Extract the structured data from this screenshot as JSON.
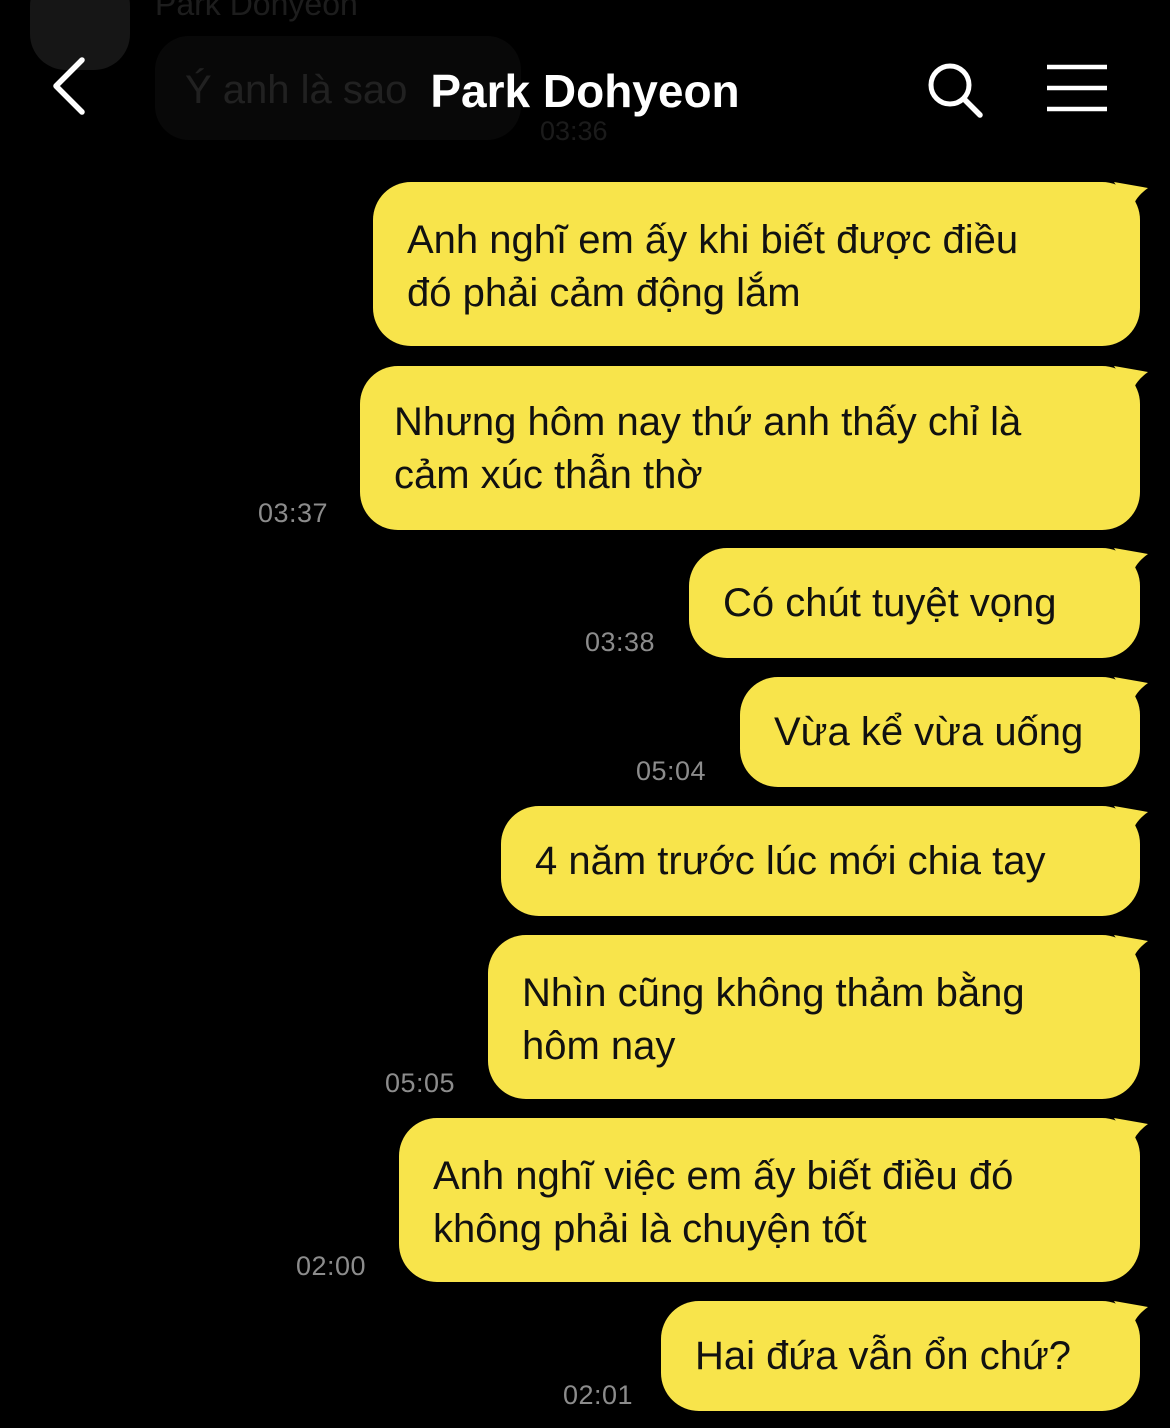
{
  "ghost": {
    "name": "Park Dohyeon",
    "message": "Ý anh là sao",
    "time": "03:36"
  },
  "header": {
    "title": "Park Dohyeon"
  },
  "icons": {
    "back": "chevron-left-icon",
    "search": "search-icon",
    "menu": "hamburger-menu-icon"
  },
  "colors": {
    "background": "#000000",
    "outgoing_bubble": "#f8e44b",
    "timestamp": "#8c8c8c",
    "title": "#ffffff"
  },
  "messages": [
    {
      "lines": [
        "Anh nghĩ em ấy khi biết được điều",
        "đó phải cảm động lắm"
      ],
      "time": ""
    },
    {
      "lines": [
        "Nhưng hôm nay thứ anh thấy chỉ là",
        "cảm xúc thẫn thờ"
      ],
      "time": "03:37"
    },
    {
      "lines": [
        "Có chút tuyệt vọng"
      ],
      "time": "03:38"
    },
    {
      "lines": [
        "Vừa kể vừa uống"
      ],
      "time": "05:04"
    },
    {
      "lines": [
        "4 năm trước lúc mới chia tay"
      ],
      "time": ""
    },
    {
      "lines": [
        "Nhìn cũng không thảm bằng",
        "hôm nay"
      ],
      "time": "05:05"
    },
    {
      "lines": [
        "Anh nghĩ việc em ấy biết điều đó",
        "không phải là chuyện tốt"
      ],
      "time": "02:00"
    },
    {
      "lines": [
        "Hai đứa vẫn ổn chứ?"
      ],
      "time": "02:01"
    }
  ]
}
